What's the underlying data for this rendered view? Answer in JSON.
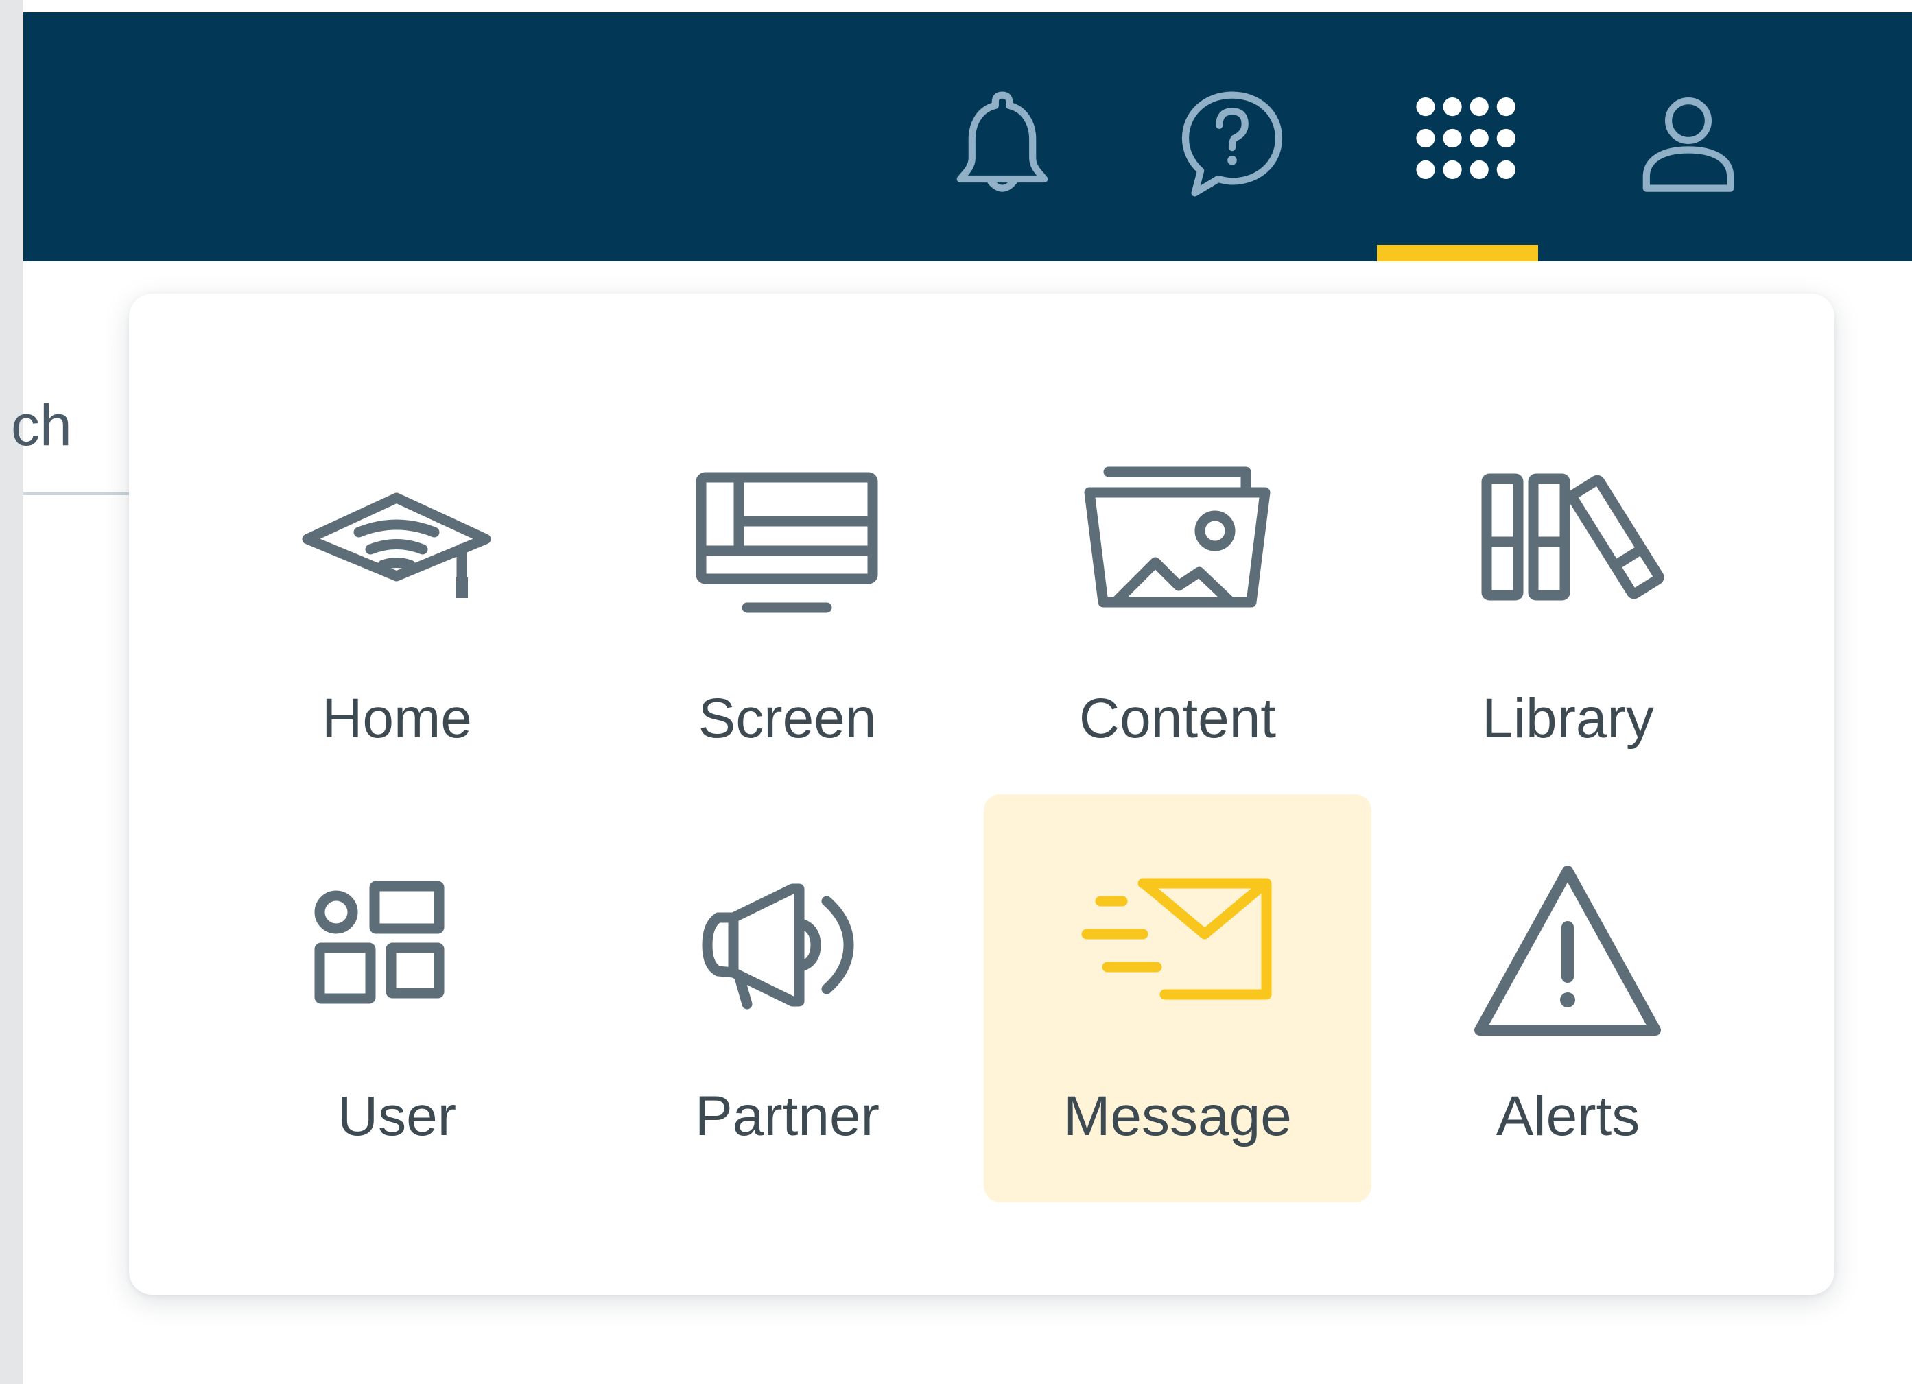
{
  "colors": {
    "header_bg": "#023755",
    "header_icon": "#8fb0c6",
    "accent": "#f8c61d",
    "icon_gray": "#5e6e78",
    "label": "#3d4a52",
    "selected_bg": "#fff3d8"
  },
  "header": {
    "icons": [
      {
        "name": "bell-icon"
      },
      {
        "name": "help-chat-icon"
      },
      {
        "name": "app-grid-icon",
        "active": true
      },
      {
        "name": "user-profile-icon"
      }
    ]
  },
  "search": {
    "visible_text": "ch"
  },
  "apps": [
    {
      "label": "Home",
      "icon": "graduation-cap-icon"
    },
    {
      "label": "Screen",
      "icon": "monitor-icon"
    },
    {
      "label": "Content",
      "icon": "photo-folder-icon"
    },
    {
      "label": "Library",
      "icon": "books-icon"
    },
    {
      "label": "User",
      "icon": "user-widgets-icon"
    },
    {
      "label": "Partner",
      "icon": "megaphone-icon"
    },
    {
      "label": "Message",
      "icon": "envelope-icon",
      "selected": true
    },
    {
      "label": "Alerts",
      "icon": "warning-triangle-icon"
    }
  ]
}
